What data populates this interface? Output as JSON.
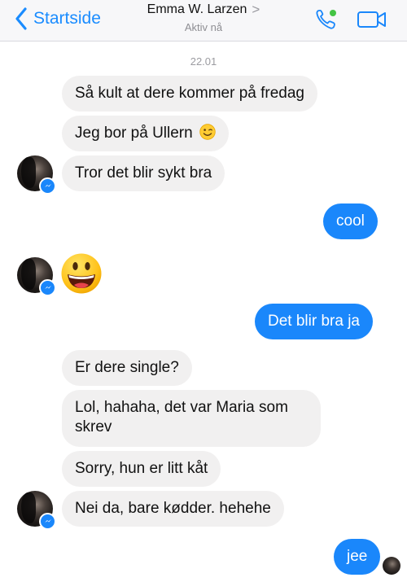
{
  "header": {
    "back_label": "Startside",
    "contact_name": "Emma W. Larzen",
    "status": "Aktiv nå",
    "chevron": ">"
  },
  "thread": {
    "date": "22.01",
    "messages": [
      {
        "side": "in",
        "text": "Så kult at dere kommer på fredag"
      },
      {
        "side": "in",
        "text": "Jeg bor på Ullern",
        "emoji": "winking-face"
      },
      {
        "side": "in",
        "text": "Tror det blir sykt bra"
      },
      {
        "side": "out",
        "text": "cool"
      },
      {
        "side": "in",
        "emoji": "grinning-face"
      },
      {
        "side": "out",
        "text": "Det blir bra ja"
      },
      {
        "side": "in",
        "text": "Er dere single?"
      },
      {
        "side": "in",
        "text": "Lol, hahaha, det var Maria som skrev"
      },
      {
        "side": "in",
        "text": "Sorry, hun er litt kåt"
      },
      {
        "side": "in",
        "text": "Nei da, bare kødder. hehehe"
      },
      {
        "side": "out",
        "text": "jee"
      }
    ]
  },
  "colors": {
    "accent": "#1a87fb",
    "incoming_bubble": "#f1f0f0",
    "online_dot": "#44c444"
  }
}
